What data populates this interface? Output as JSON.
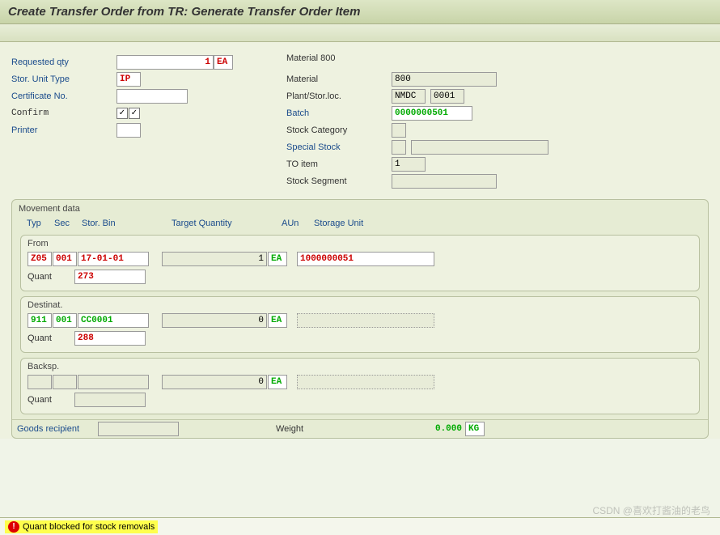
{
  "title": "Create Transfer Order from TR: Generate Transfer Order Item",
  "left": {
    "requested_qty_label": "Requested qty",
    "requested_qty": "1",
    "requested_qty_uom": "EA",
    "stor_unit_type_label": "Stor. Unit Type",
    "stor_unit_type": "IP",
    "certificate_label": "Certificate No.",
    "certificate": "",
    "confirm_label": "Confirm",
    "confirm1": "✓",
    "confirm2": "✓",
    "printer_label": "Printer",
    "printer": ""
  },
  "right": {
    "material_desc": "Material 800",
    "material_label": "Material",
    "material": "800",
    "plant_label": "Plant/Stor.loc.",
    "plant": "NMDC",
    "sloc": "0001",
    "batch_label": "Batch",
    "batch": "0000000501",
    "stock_cat_label": "Stock Category",
    "stock_cat": "",
    "special_stock_label": "Special Stock",
    "special_stock": "",
    "special_stock_ref": "",
    "to_item_label": "TO item",
    "to_item": "1",
    "stock_segment_label": "Stock Segment",
    "stock_segment": ""
  },
  "movement": {
    "title": "Movement data",
    "headers": {
      "typ": "Typ",
      "sec": "Sec",
      "bin": "Stor. Bin",
      "tqty": "Target Quantity",
      "aun": "AUn",
      "su": "Storage Unit"
    },
    "from": {
      "title": "From",
      "typ": "Z05",
      "sec": "001",
      "bin": "17-01-01",
      "qty": "1",
      "uom": "EA",
      "su": "1000000051",
      "quant_label": "Quant",
      "quant": "273"
    },
    "dest": {
      "title": "Destinat.",
      "typ": "911",
      "sec": "001",
      "bin": "CC0001",
      "qty": "0",
      "uom": "EA",
      "su": "",
      "quant_label": "Quant",
      "quant": "288"
    },
    "back": {
      "title": "Backsp.",
      "typ": "",
      "sec": "",
      "bin": "",
      "qty": "0",
      "uom": "EA",
      "su": "",
      "quant_label": "Quant",
      "quant": ""
    }
  },
  "footer": {
    "goods_recipient_label": "Goods recipient",
    "goods_recipient": "",
    "weight_label": "Weight",
    "weight": "0.000",
    "weight_uom": "KG"
  },
  "status": {
    "message": "Quant blocked for stock removals"
  },
  "watermark": "CSDN @喜欢打酱油的老鸟"
}
